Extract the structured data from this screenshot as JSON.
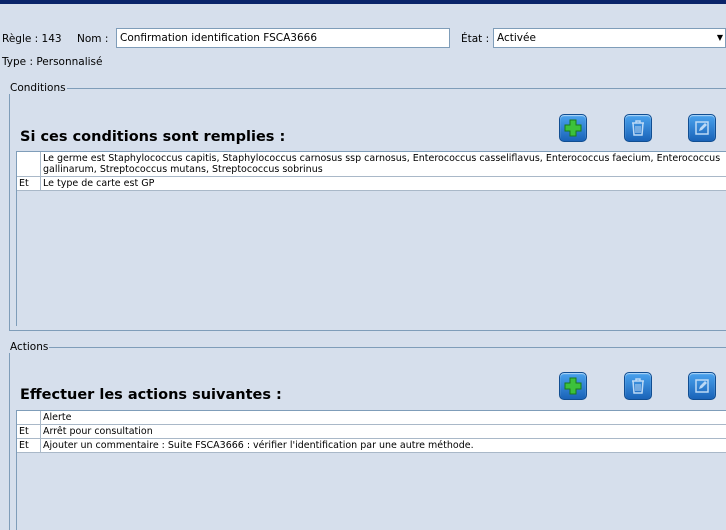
{
  "header": {
    "regle_label": "Règle : 143",
    "nom_label": "Nom :",
    "nom_value": "Confirmation identification  FSCA3666",
    "etat_label": "État :",
    "etat_value": "Activée",
    "type_label": "Type : Personnalisé"
  },
  "conditions": {
    "legend": "Conditions",
    "title": "Si ces conditions sont remplies :",
    "rows": [
      {
        "op": "",
        "text": "Le germe est Staphylococcus capitis, Staphylococcus carnosus ssp carnosus, Enterococcus casseliflavus, Enterococcus faecium, Enterococcus gallinarum, Streptococcus mutans, Streptococcus sobrinus"
      },
      {
        "op": "Et",
        "text": "Le type de carte est GP"
      }
    ]
  },
  "actions": {
    "legend": "Actions",
    "title": "Effectuer les actions suivantes :",
    "rows": [
      {
        "op": "",
        "text": "Alerte"
      },
      {
        "op": "Et",
        "text": "Arrêt pour consultation"
      },
      {
        "op": "Et",
        "text": "Ajouter un commentaire : Suite FSCA3666 : vérifier l'identification par une autre méthode."
      }
    ]
  },
  "icons": {
    "add": "add-icon",
    "delete": "trash-icon",
    "edit": "edit-icon"
  },
  "colors": {
    "background": "#d6dfec",
    "accent": "#1a63b8",
    "add_plus": "#3cc13c"
  }
}
